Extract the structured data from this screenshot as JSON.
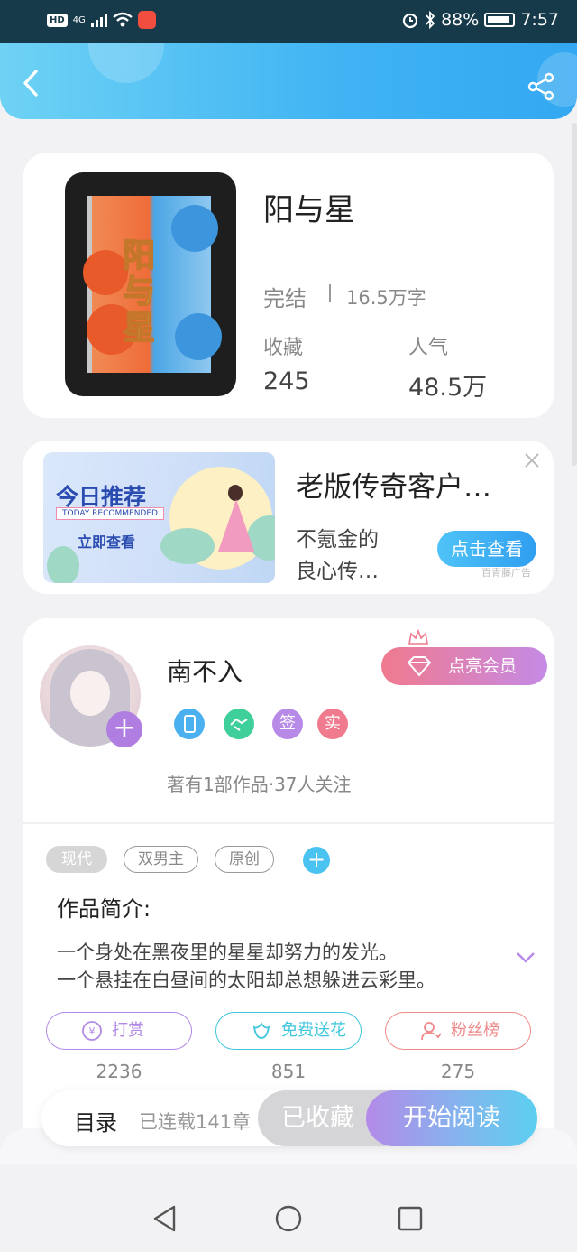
{
  "status_bar": {
    "hd": "HD",
    "signal": "4G",
    "battery": "88%",
    "time": "7:57"
  },
  "book": {
    "title": "阳与星",
    "cover_title": "阳与星",
    "status": "完结",
    "word_count": "16.5万字",
    "favorites_label": "收藏",
    "favorites_value": "245",
    "popularity_label": "人气",
    "popularity_value": "48.5万"
  },
  "ad": {
    "banner_title": "今日推荐",
    "banner_en": "TODAY RECOMMENDED",
    "banner_link": "立即查看",
    "title": "老版传奇客户…",
    "desc_line1": "不氪金的",
    "desc_line2": "良心传…",
    "button": "点击查看",
    "source": "百青藤广告"
  },
  "author": {
    "name": "南不入",
    "vip_button": "点亮会员",
    "badges": [
      {
        "name": "phone-badge",
        "text": "",
        "color": "#4ab0f0"
      },
      {
        "name": "handshake-badge",
        "text": "",
        "color": "#3fcf9a"
      },
      {
        "name": "sign-badge",
        "text": "签",
        "color": "#b78ae8"
      },
      {
        "name": "verified-badge",
        "text": "实",
        "color": "#f07a8e"
      }
    ],
    "stats": "著有1部作品·37人关注"
  },
  "tags": [
    "现代",
    "双男主",
    "原创"
  ],
  "intro": {
    "label": "作品简介:",
    "line1": "一个身处在黑夜里的星星却努力的发光。",
    "line2": "一个悬挂在白昼间的太阳却总想躲进云彩里。"
  },
  "actions": [
    {
      "label": "打赏",
      "count": "2236",
      "color": "#b28ae6",
      "icon": "coin-icon"
    },
    {
      "label": "免费送花",
      "count": "851",
      "color": "#3fc6dc",
      "icon": "flower-icon"
    },
    {
      "label": "粉丝榜",
      "count": "275",
      "color": "#ef8a8a",
      "icon": "fan-icon"
    }
  ],
  "bottom_bar": {
    "toc": "目录",
    "progress": "已连载141章",
    "favorited": "已收藏",
    "read": "开始阅读"
  }
}
